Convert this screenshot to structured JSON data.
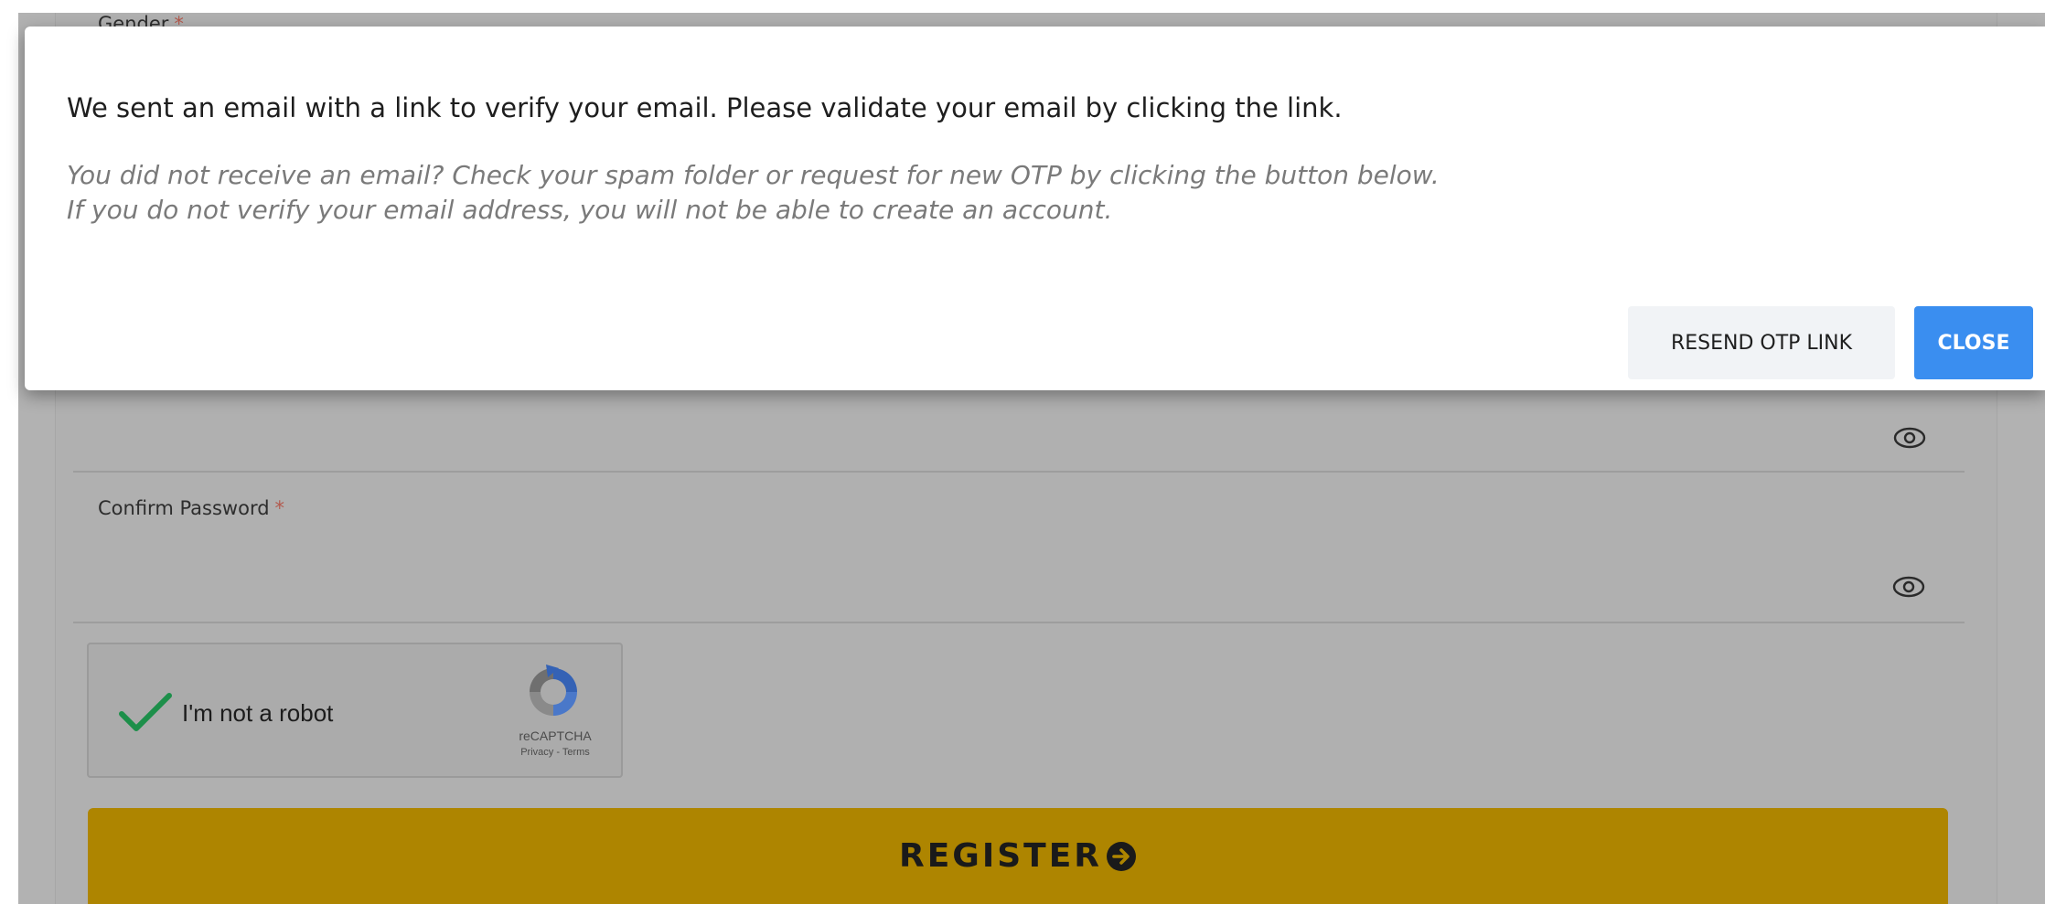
{
  "background_form": {
    "gender_label": "Gender",
    "gender_required_mark": "*",
    "password_field": {
      "value": ""
    },
    "confirm_password": {
      "label": "Confirm Password",
      "required_mark": "*",
      "value": ""
    },
    "recaptcha": {
      "checked": true,
      "label": "I'm not a robot",
      "brand": "reCAPTCHA",
      "links": "Privacy - Terms"
    },
    "register_button": {
      "label": "REGISTER",
      "icon": "arrow-circle-right-icon"
    }
  },
  "dialog": {
    "message": "We sent an email with a link to verify your email. Please validate your email by clicking the link.",
    "hint_line_1": "You did not receive an email? Check your spam folder or request for new OTP by clicking the button below.",
    "hint_line_2": "If you do not verify your email address, you will not be able to create an account.",
    "resend_button": "RESEND OTP LINK",
    "close_button": "CLOSE"
  },
  "colors": {
    "primary": "#3a8ef0",
    "register": "#ae8500",
    "overlay_page": "#b2b2b2"
  }
}
